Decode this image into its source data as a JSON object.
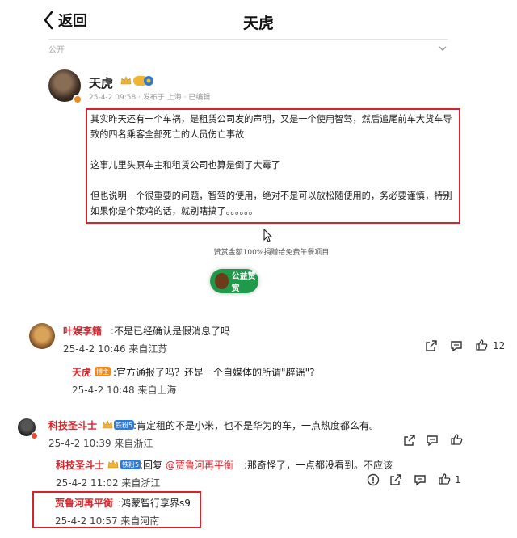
{
  "header": {
    "back_label": "返回",
    "title": "天虎"
  },
  "visibility": {
    "label": "公开"
  },
  "post": {
    "author": "天虎",
    "meta": "25-4-2 09:58 · 发布于 上海 · 已编辑",
    "paragraphs": [
      "其实昨天还有一个车祸，是租赁公司发的声明，又是一个使用智驾，然后追尾前车大货车导致的四名乘客全部死亡的人员伤亡事故",
      "这事儿里头原车主和租赁公司也算是倒了大霉了",
      "但也说明一个很重要的问题，智驾的使用，绝对不是可以放松随便用的，务必要谨慎，特别如果你是个菜鸡的话，就别瞎搞了。。。。。。"
    ]
  },
  "charity": {
    "note": "赞赏金额100%捐赠给免费午餐项目",
    "button_label": "公益赞赏"
  },
  "comments": [
    {
      "user": "叶娱李籍",
      "text": ":不是已经确认是假消息了吗",
      "time": "25-4-2 10:46 来自江苏",
      "likes": "12"
    },
    {
      "user": "天虎",
      "tag": "博主",
      "text": ":官方通报了吗？还是一个自媒体的所谓\"辟谣\"?",
      "time": "25-4-2 10:48 来自上海"
    },
    {
      "user": "科技圣斗士",
      "tag": "铁粉5",
      "text": ":肯定租的不是小米，也不是华为的车，一点热度都么有。",
      "time": "25-4-2 10:39 来自浙江"
    },
    {
      "user": "科技圣斗士",
      "tag": "铁粉5",
      "reply_prefix": ":回复",
      "mention": "@贾鲁河再平衡",
      "text": ":那奇怪了，一点都没看到。不应该",
      "time": "25-4-2 11:02 来自浙江",
      "likes": "1"
    },
    {
      "user": "贾鲁河再平衡",
      "text": ":鸿蒙智行享界s9",
      "time": "25-4-2 10:57 来自河南"
    }
  ],
  "colors": {
    "accent_red": "#d8232a",
    "tag_orange": "#f08a1a",
    "tag_blue": "#2e7bd6",
    "charity_green": "#1f9a4b"
  },
  "icons": [
    "chevron-left-icon",
    "chevron-down-icon",
    "crown-icon",
    "verified-icon",
    "share-icon",
    "comment-icon",
    "like-icon",
    "info-icon",
    "cursor-icon"
  ]
}
